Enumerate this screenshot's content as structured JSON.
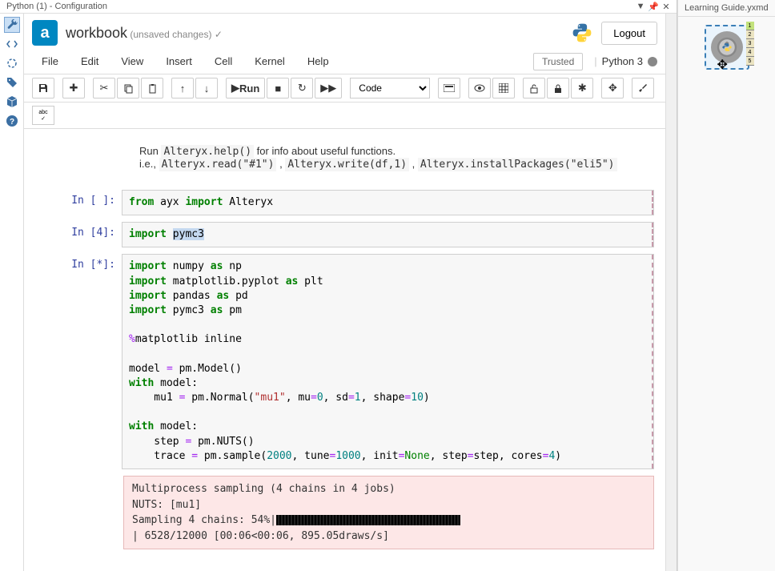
{
  "titlebar": {
    "title": "Python (1) - Configuration",
    "right_tab": "Learning Guide.yxmd"
  },
  "header": {
    "logo_letter": "a",
    "workbook_label": "workbook",
    "status": "(unsaved changes)",
    "checkmark": "✓",
    "logout": "Logout"
  },
  "menubar": {
    "items": [
      "File",
      "Edit",
      "View",
      "Insert",
      "Cell",
      "Kernel",
      "Help"
    ],
    "trusted": "Trusted",
    "kernel": "Python 3"
  },
  "toolbar": {
    "run_label": "Run",
    "celltype": "Code",
    "abc_label": "abc"
  },
  "intro": {
    "line1_pre": "Run ",
    "line1_code": "Alteryx.help()",
    "line1_post": " for info about useful functions.",
    "line2_pre": "i.e., ",
    "snip1": "Alteryx.read(\"#1\")",
    "sep": " , ",
    "snip2": "Alteryx.write(df,1)",
    "snip3": "Alteryx.installPackages(\"eli5\")"
  },
  "cells": [
    {
      "prompt": "In [ ]:",
      "raw": "from ayx import Alteryx"
    },
    {
      "prompt": "In [4]:",
      "raw": "import pymc3"
    },
    {
      "prompt": "In [*]:",
      "raw": "import numpy as np\nimport matplotlib.pyplot as plt\nimport pandas as pd\nimport pymc3 as pm\n\n%matplotlib inline\n\nmodel = pm.Model()\nwith model:\n    mu1 = pm.Normal(\"mu1\", mu=0, sd=1, shape=10)\n\nwith model:\n    step = pm.NUTS()\n    trace = pm.sample(2000, tune=1000, init=None, step=step, cores=4)"
    }
  ],
  "output": {
    "line1": "Multiprocess sampling (4 chains in 4 jobs)",
    "line2": "NUTS: [mu1]",
    "line3_pre": "Sampling 4 chains:  54%|",
    "line4": "| 6528/12000 [00:06<00:06, 895.05draws/s]"
  },
  "canvas": {
    "anchors": [
      "1",
      "2",
      "3",
      "4",
      "5"
    ]
  }
}
